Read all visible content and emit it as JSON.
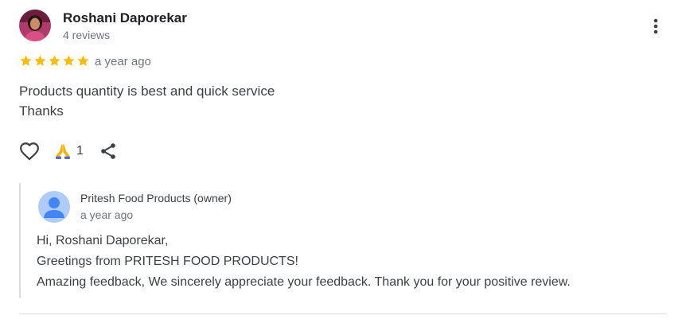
{
  "review": {
    "reviewer_name": "Roshani Daporekar",
    "review_count": "4 reviews",
    "rating": 5,
    "rating_max": 5,
    "time": "a year ago",
    "text_lines": [
      "Products quantity is best and quick service",
      "Thanks"
    ],
    "actions": {
      "praise_count": "1",
      "like_icon": "heart-outline-icon",
      "praise_icon": "folded-hands-icon",
      "share_icon": "share-icon"
    }
  },
  "owner_reply": {
    "name": "Pritesh Food Products (owner)",
    "time": "a year ago",
    "lines": [
      "Hi, Roshani Daporekar,",
      "Greetings from PRITESH FOOD PRODUCTS!",
      "Amazing feedback, We sincerely appreciate your feedback. Thank you for your positive review."
    ]
  },
  "colors": {
    "star": "#fbbc04",
    "text_primary": "#202124",
    "text_secondary": "#70757a",
    "icon": "#3c4043",
    "reply_border": "#dadce0",
    "owner_avatar_bg": "#aecbfa",
    "owner_avatar_fg": "#4285f4"
  }
}
